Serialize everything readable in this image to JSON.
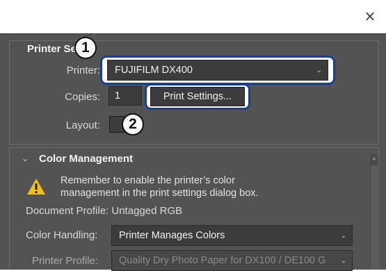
{
  "window": {
    "close_glyph": "×"
  },
  "printer_setup": {
    "title": "Printer Setup",
    "printer_label": "Printer:",
    "printer_value": "FUJIFILM DX400",
    "copies_label": "Copies:",
    "copies_value": "1",
    "print_settings_button": "Print Settings...",
    "layout_label": "Layout:"
  },
  "callouts": [
    "1",
    "2"
  ],
  "color_management": {
    "title": "Color Management",
    "warning_line1": "Remember to enable the printer’s color",
    "warning_line2": "management in the print settings dialog box.",
    "document_profile": "Document Profile: Untagged RGB",
    "color_handling_label": "Color Handling:",
    "color_handling_value": "Printer Manages Colors",
    "printer_profile_label": "Printer Profile:",
    "printer_profile_value": "Quality Dry Photo Paper for DX100 / DE100 G"
  },
  "colors": {
    "dialog_bg": "#535353",
    "callout_border": "#1b3f8f",
    "warning": "#f2c200"
  }
}
